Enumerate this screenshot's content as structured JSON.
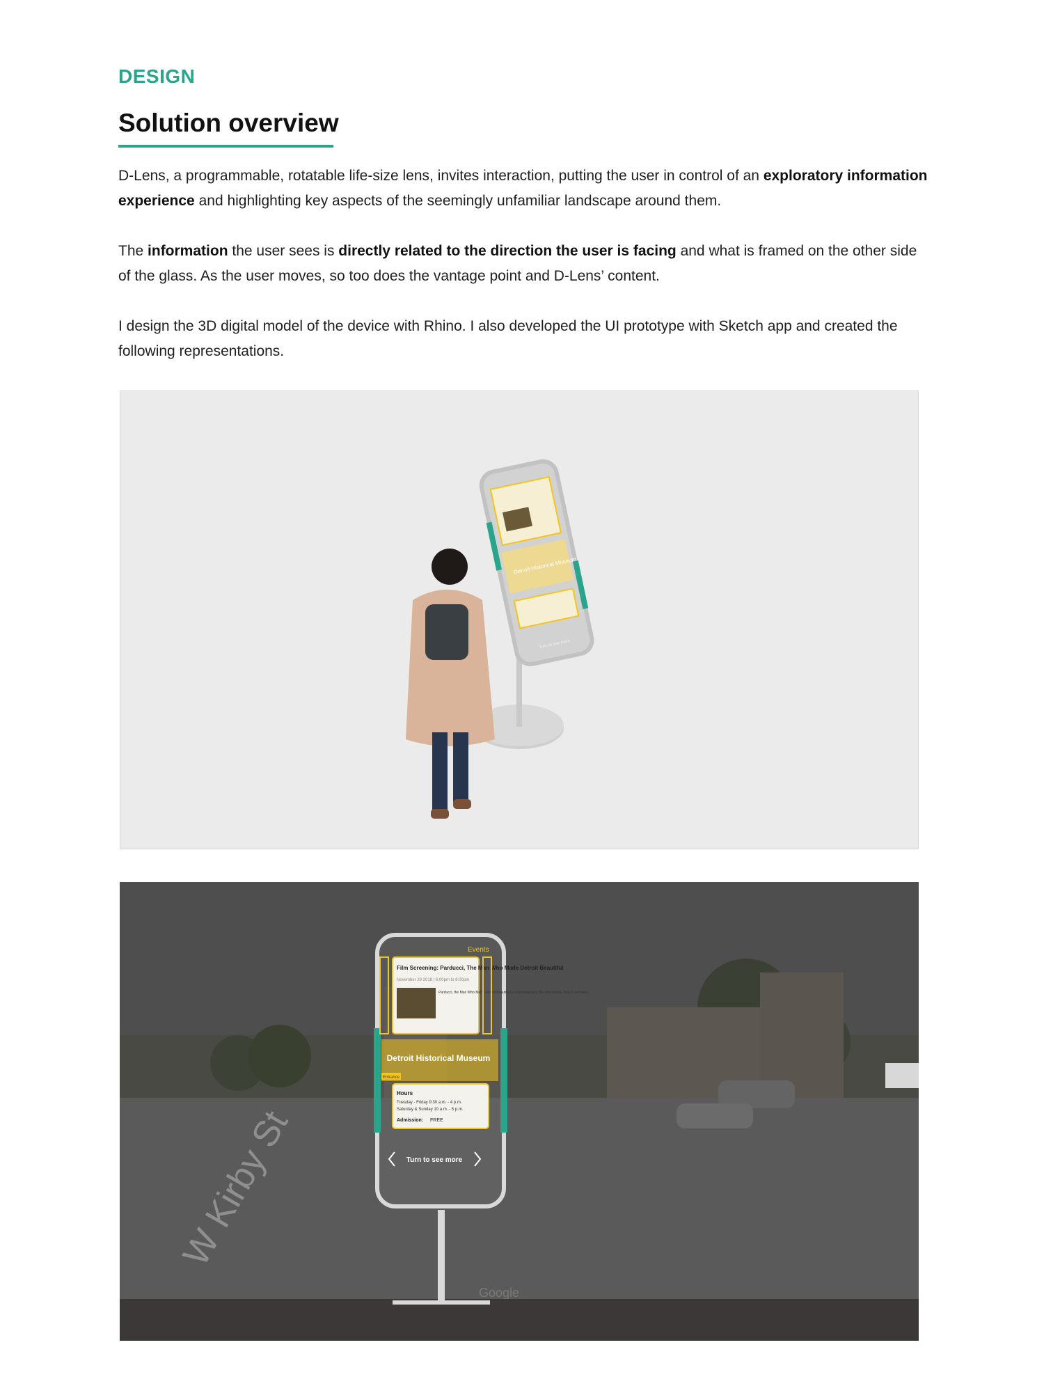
{
  "header": {
    "eyebrow": "DESIGN",
    "title": "Solution overview"
  },
  "paragraphs": {
    "p1": {
      "s1": "D-Lens, a programmable, rotatable life-size lens, invites interaction, putting the user in control of an ",
      "b1": "exploratory information experience",
      "s2": " and highlighting key aspects of the seemingly unfamiliar landscape around them."
    },
    "p2": {
      "s1": "The ",
      "b1": "information",
      "s2": " the user sees is ",
      "b2": "directly related to the direction the user is facing",
      "s3": " and what is framed on the other side of the glass. As the user moves, so too does the vantage point and D-Lens’ content."
    },
    "p3": {
      "s1": "I design the 3D digital model of the device with Rhino. I also developed the UI prototype with Sketch app and created the following representations."
    }
  },
  "lens_ui": {
    "section_label": "Events",
    "event_title": "Film Screening: Parducci, The Man Who Made Detroit Beautiful",
    "event_date": "November 29 2018 | 6:00pm to 8:00pm",
    "event_desc": "Parducci, the Man Who Made Detroit Beautiful is a documentary film directed by Jack P. Johnson.",
    "place_name": "Detroit Historical Museum",
    "place_tag": "Entrance",
    "hours_label": "Hours",
    "hours_weekday": "Tuesday - Friday   9:30 a.m. - 4 p.m.",
    "hours_weekend": "Saturday & Sunday  10 a.m. - 5 p.m.",
    "admission_label": "Admission:",
    "admission_value": "FREE",
    "nav_hint": "Turn to see more"
  },
  "street_view": {
    "street_sign": "W Kirby St",
    "watermark": "Google"
  },
  "colors": {
    "accent": "#2aa58b",
    "lens_highlight": "#f2c61f"
  }
}
